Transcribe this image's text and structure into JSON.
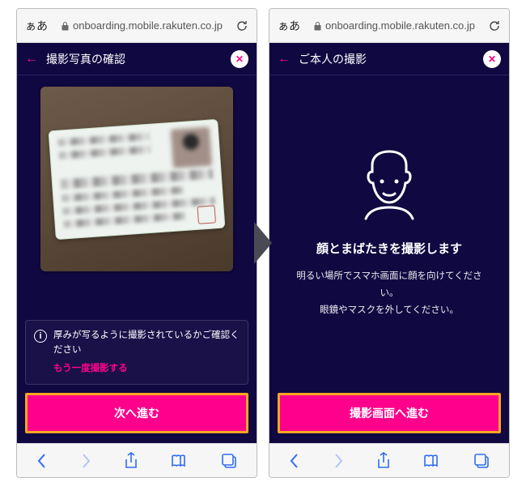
{
  "browser": {
    "aa_label": "ぁあ",
    "url": "onboarding.mobile.rakuten.co.jp"
  },
  "screen1": {
    "title": "撮影写真の確認",
    "hint_text": "厚みが写るように撮影されているかご確認ください",
    "retake_label": "もう一度撮影する",
    "cta_label": "次へ進む"
  },
  "screen2": {
    "title": "ご本人の撮影",
    "headline": "顔とまばたきを撮影します",
    "sub1": "明るい場所でスマホ画面に顔を向けてください。",
    "sub2": "眼鏡やマスクを外してください。",
    "cta_label": "撮影画面へ進む"
  },
  "icons": {
    "info": "i"
  }
}
